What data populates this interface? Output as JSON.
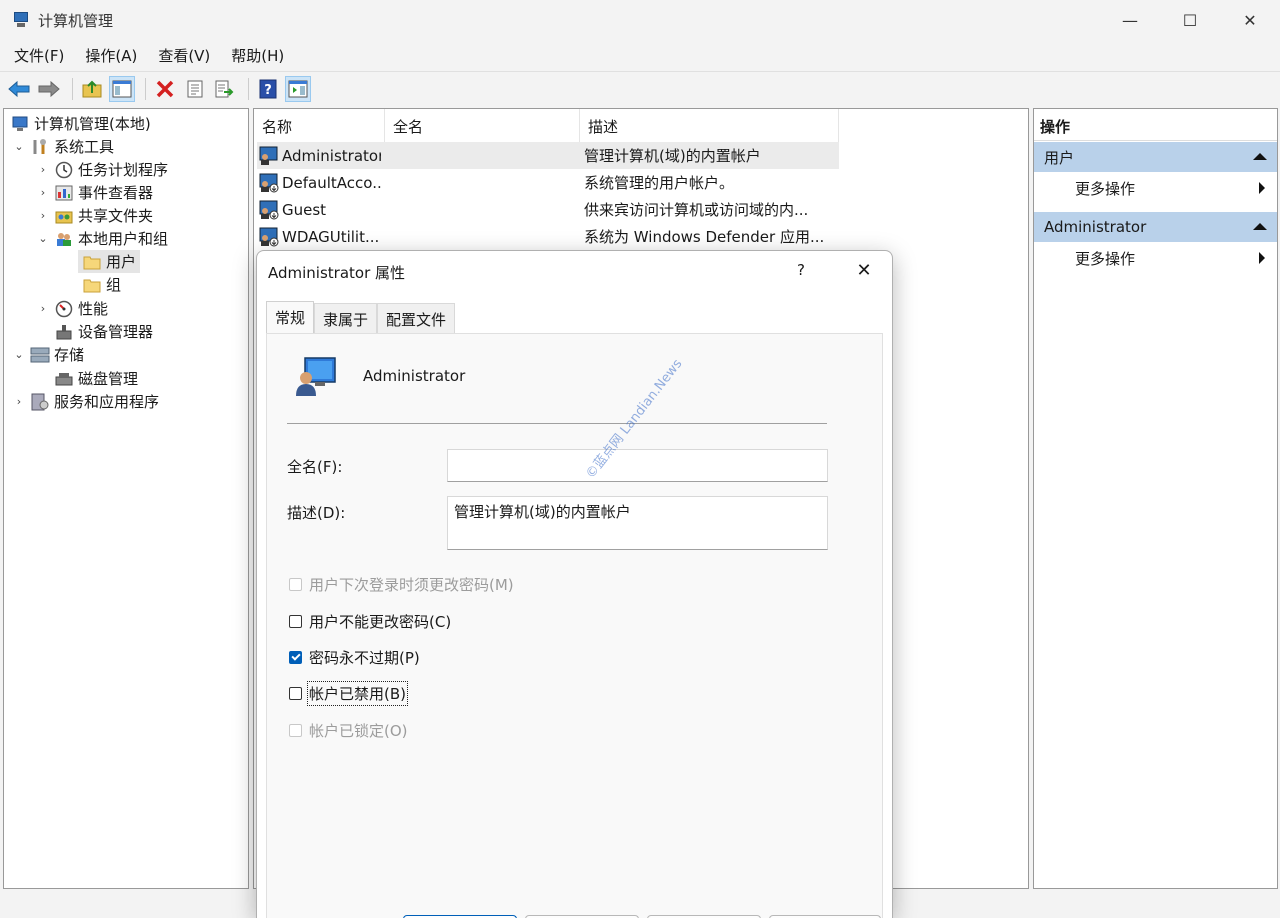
{
  "window": {
    "title": "计算机管理",
    "controls": [
      "—",
      "☐",
      "✕"
    ]
  },
  "menu": [
    "文件(F)",
    "操作(A)",
    "查看(V)",
    "帮助(H)"
  ],
  "tree": [
    {
      "label": "计算机管理(本地)"
    },
    {
      "label": "系统工具"
    },
    {
      "label": "任务计划程序"
    },
    {
      "label": "事件查看器"
    },
    {
      "label": "共享文件夹"
    },
    {
      "label": "本地用户和组"
    },
    {
      "label": "用户"
    },
    {
      "label": "组"
    },
    {
      "label": "性能"
    },
    {
      "label": "设备管理器"
    },
    {
      "label": "存储"
    },
    {
      "label": "磁盘管理"
    },
    {
      "label": "服务和应用程序"
    }
  ],
  "list": {
    "columns": [
      "名称",
      "全名",
      "描述"
    ],
    "rows": [
      {
        "name": "Administrator",
        "fullname": "",
        "desc": "管理计算机(域)的内置帐户"
      },
      {
        "name": "DefaultAcco...",
        "fullname": "",
        "desc": "系统管理的用户帐户。"
      },
      {
        "name": "Guest",
        "fullname": "",
        "desc": "供来宾访问计算机或访问域的内..."
      },
      {
        "name": "WDAGUtilit...",
        "fullname": "",
        "desc": "系统为 Windows Defender 应用..."
      }
    ]
  },
  "actions": {
    "title": "操作",
    "sections": [
      {
        "label": "用户",
        "item": "更多操作"
      },
      {
        "label": "Administrator",
        "item": "更多操作"
      }
    ]
  },
  "dialog": {
    "title": "Administrator 属性",
    "help": "?",
    "close": "✕",
    "tabs": [
      "常规",
      "隶属于",
      "配置文件"
    ],
    "username": "Administrator",
    "fullname_label": "全名(F):",
    "fullname_value": "",
    "desc_label": "描述(D):",
    "desc_value": "管理计算机(域)的内置帐户",
    "checkboxes": [
      {
        "label": "用户下次登录时须更改密码(M)",
        "checked": false,
        "disabled": true
      },
      {
        "label": "用户不能更改密码(C)",
        "checked": false,
        "disabled": false
      },
      {
        "label": "密码永不过期(P)",
        "checked": true,
        "disabled": false
      },
      {
        "label": "帐户已禁用(B)",
        "checked": false,
        "disabled": false
      },
      {
        "label": "帐户已锁定(O)",
        "checked": false,
        "disabled": true
      }
    ]
  },
  "watermark": "©蓝点网 Landian.News"
}
